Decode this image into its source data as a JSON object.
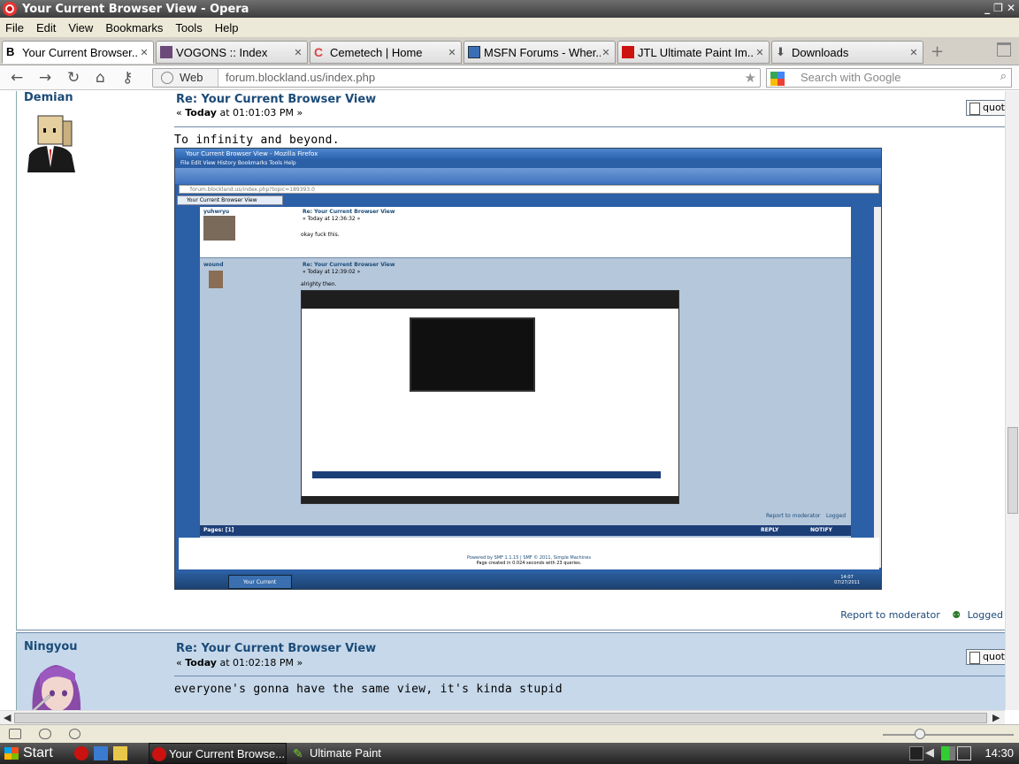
{
  "window": {
    "title": "Your Current Browser View - Opera",
    "controls": [
      "_",
      "❐",
      "✕"
    ]
  },
  "menu": [
    "File",
    "Edit",
    "View",
    "Bookmarks",
    "Tools",
    "Help"
  ],
  "tabs": [
    {
      "label": "Your Current Browser..."
    },
    {
      "label": "VOGONS :: Index"
    },
    {
      "label": "Cemetech | Home"
    },
    {
      "label": "MSFN Forums - Wher..."
    },
    {
      "label": "JTL Ultimate Paint Im..."
    },
    {
      "label": "Downloads"
    }
  ],
  "address": {
    "web_label": "Web",
    "url": "forum.blockland.us/index.php",
    "search_placeholder": "Search with Google"
  },
  "posts": [
    {
      "author": "Demian",
      "title": "Re: Your Current Browser View",
      "meta_prefix": "« ",
      "meta_day": "Today",
      "meta_time": " at 01:01:03 PM »",
      "body": "To infinity and beyond.",
      "quote_label": "quote",
      "report": "Report to moderator",
      "logged": "Logged"
    },
    {
      "author": "Ningyou",
      "title": "Re: Your Current Browser View",
      "meta_prefix": "« ",
      "meta_day": "Today",
      "meta_time": " at 01:02:18 PM »",
      "body": "everyone's gonna have the same view, it's kinda stupid",
      "quote_label": "quote"
    }
  ],
  "embedded": {
    "title": "Your Current Browser View - Mozilla Firefox",
    "menu": "File  Edit  View  History  Bookmarks  Tools  Help",
    "url": "forum.blockland.us/index.php?topic=189393.0",
    "tab": "Your Current Browser View",
    "post1_author": "yuhwryu",
    "post1_title": "Re: Your Current Browser View",
    "post1_meta": "« Today at 12:36:32 »",
    "post1_body": "okay fuck this.",
    "post2_author": "wound",
    "post2_title": "Re: Your Current Browser View",
    "post2_meta": "« Today at 12:39:02 »",
    "post2_body": "alrighty then.",
    "report": "Report to moderator",
    "logged": "Logged",
    "pages": "Pages: [1]",
    "reply": "REPLY",
    "notify": "NOTIFY",
    "footer1": "Powered by SMF 1.1.15 | SMF © 2011, Simple Machines",
    "footer2": "Page created in 0.024 seconds with 23 queries.",
    "task_item": "Your Current Bro...",
    "clock": "14:07\n07/27/2011"
  },
  "statusbar": {},
  "taskbar": {
    "start": "Start",
    "items": [
      {
        "label": "Your Current Browse..."
      },
      {
        "label": "Ultimate Paint"
      }
    ],
    "clock": "14:30"
  }
}
